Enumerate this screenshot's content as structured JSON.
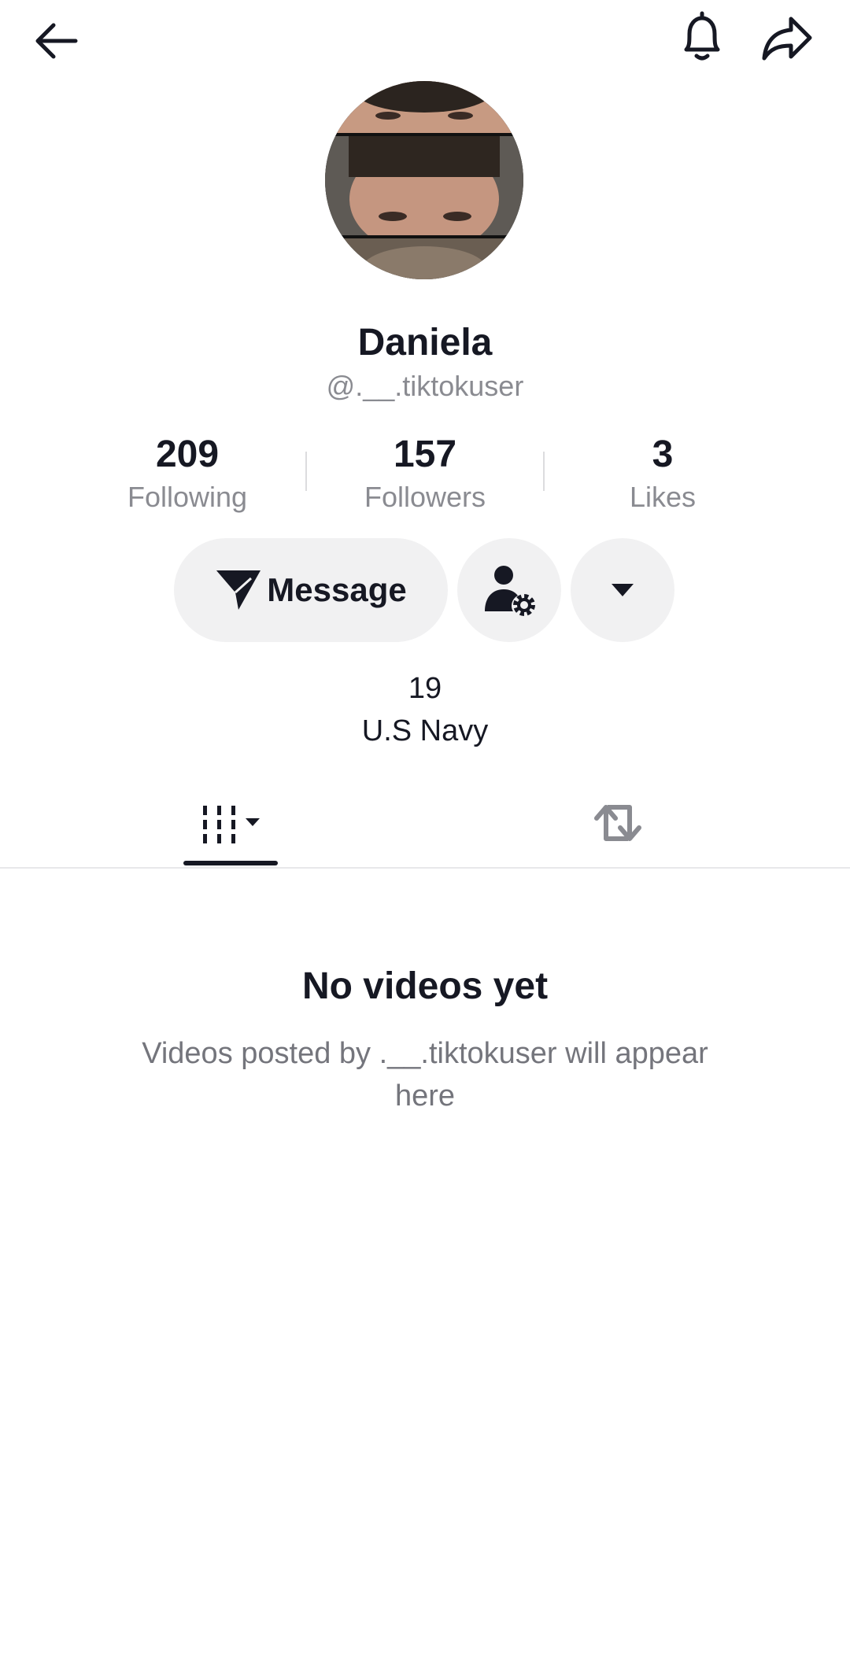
{
  "header": {
    "back_icon": "back-arrow-icon",
    "bell_icon": "bell-icon",
    "share_icon": "share-arrow-icon"
  },
  "profile": {
    "display_name": "Daniela",
    "username": "@.__.tiktokuser",
    "stats": {
      "following": {
        "value": "209",
        "label": "Following"
      },
      "followers": {
        "value": "157",
        "label": "Followers"
      },
      "likes": {
        "value": "3",
        "label": "Likes"
      }
    },
    "bio_lines": [
      "19",
      "U.S Navy"
    ]
  },
  "actions": {
    "message_label": "Message",
    "message_icon": "send-icon",
    "friend_icon": "person-gear-icon",
    "more_icon": "caret-down-icon"
  },
  "tabs": {
    "videos_icon": "video-grid-icon",
    "reposts_icon": "repost-icon",
    "active": "videos"
  },
  "empty_state": {
    "title": "No videos yet",
    "subtitle": "Videos posted by .__.tiktokuser will appear here"
  },
  "colors": {
    "text_primary": "#161823",
    "text_secondary": "#8a8b91",
    "button_bg": "#f1f1f2"
  }
}
